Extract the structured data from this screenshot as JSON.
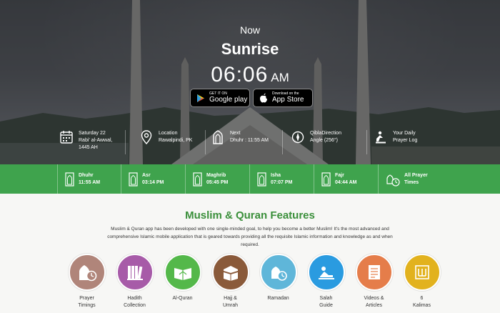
{
  "hero": {
    "now_label": "Now",
    "current_prayer": "Sunrise",
    "time": "06:06",
    "ampm": "AM"
  },
  "stores": [
    {
      "small": "GET IT ON",
      "big": "Google play",
      "icon": "google-play-icon"
    },
    {
      "small": "Download on the",
      "big": "App Store",
      "icon": "apple-icon"
    }
  ],
  "info": [
    {
      "line1": "Saturday 22",
      "line2": "Rabi' al-Awwal,",
      "line3": "1445 AH",
      "icon": "calendar-icon"
    },
    {
      "line1": "Location",
      "line2": "Rawalpindi, PK",
      "icon": "location-pin-icon"
    },
    {
      "line1": "Next",
      "line2": "Dhuhr : 11:55 AM",
      "icon": "mihrab-icon"
    },
    {
      "line1": "QiblaDirection",
      "line2": "Angle (256°)",
      "icon": "compass-icon"
    },
    {
      "line1": "Your Daily",
      "line2": "Prayer Log",
      "icon": "prayer-log-icon"
    }
  ],
  "prayer_times": [
    {
      "name": "Dhuhr",
      "time": "11:55 AM"
    },
    {
      "name": "Asr",
      "time": "03:14 PM"
    },
    {
      "name": "Maghrib",
      "time": "05:45 PM"
    },
    {
      "name": "Isha",
      "time": "07:07 PM"
    },
    {
      "name": "Fajr",
      "time": "04:44 AM"
    }
  ],
  "all_prayer": {
    "line1": "All Prayer",
    "line2": "Times"
  },
  "features": {
    "title": "Muslim & Quran Features",
    "description": "Muslim & Quran app has been developed with one single-minded goal, to help you become a better Muslim! It's the most advanced and comprehensive Islamic mobile application that is geared towards providing all the requisite Islamic information and knowledge as and when required.",
    "items": [
      {
        "label1": "Prayer",
        "label2": "Timings",
        "color": "#b0857a",
        "icon": "prayer-timings-icon"
      },
      {
        "label1": "Hadith",
        "label2": "Collection",
        "color": "#a75ba8",
        "icon": "books-icon"
      },
      {
        "label1": "Al-Quran",
        "label2": "",
        "color": "#54b84a",
        "icon": "quran-icon"
      },
      {
        "label1": "Hajj &",
        "label2": "Umrah",
        "color": "#8a5a3a",
        "icon": "kaaba-icon"
      },
      {
        "label1": "Ramadan",
        "label2": "",
        "color": "#5fb6d9",
        "icon": "ramadan-icon"
      },
      {
        "label1": "Salah",
        "label2": "Guide",
        "color": "#2a9be0",
        "icon": "salah-icon"
      },
      {
        "label1": "Videos &",
        "label2": "Articles",
        "color": "#e57d4a",
        "icon": "articles-icon"
      },
      {
        "label1": "6",
        "label2": "Kalimas",
        "color": "#e2b21e",
        "icon": "kalima-icon"
      }
    ]
  },
  "colors": {
    "green": "#3fa34d",
    "title_green": "#3a8f3a"
  }
}
